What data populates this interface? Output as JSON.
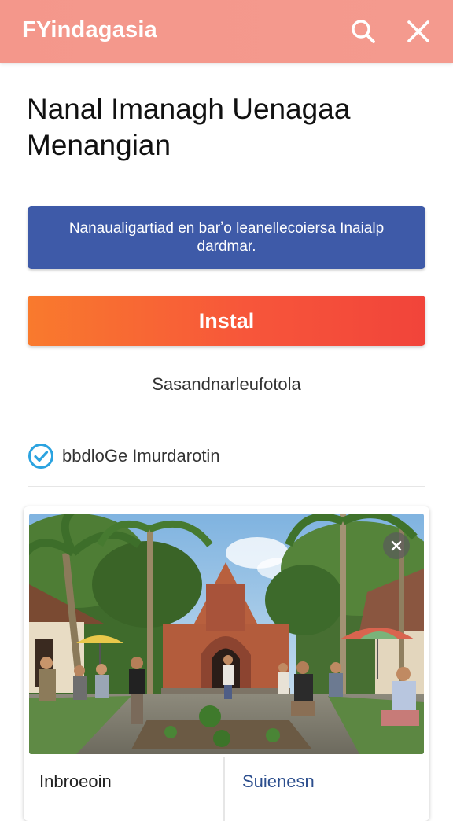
{
  "header": {
    "app_title": "FYindagasia",
    "search_icon": "search-icon",
    "close_icon": "close-icon",
    "background_color": "#f4978b"
  },
  "main": {
    "title": "Nanal Imanagh Uenagaa Menangian",
    "banner_text": "Nanaualigartiad en barʼo leanellecoiersa Inaialp dardmar.",
    "banner_color": "#3e5aa8",
    "install_label": "Instal",
    "install_color": "#f7563a",
    "secondary_link": "Sasandnarleufotola",
    "check_label": "bbdloGe Imurdarotin",
    "check_icon": "check-circle-icon",
    "check_color": "#2ba3e0"
  },
  "card": {
    "photo_close_icon": "close-icon",
    "tab_left": "Inbroeoin",
    "tab_right": "Suienesn"
  }
}
